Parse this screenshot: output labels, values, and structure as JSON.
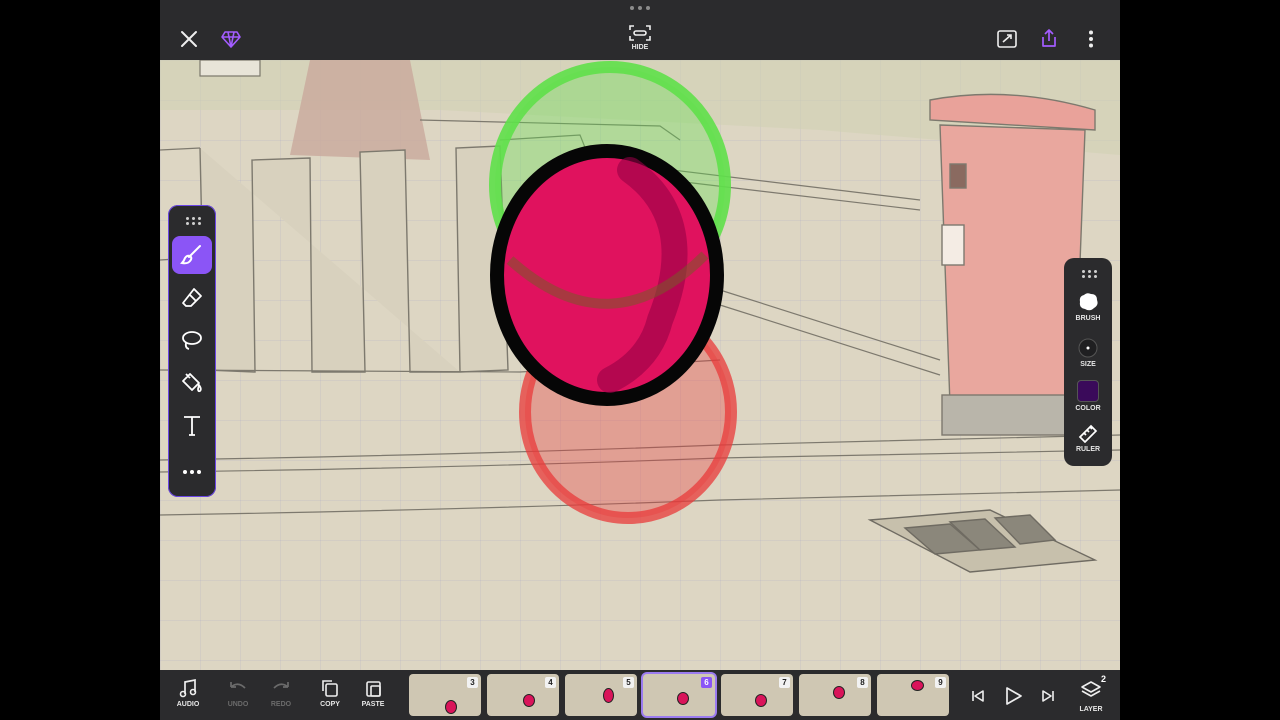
{
  "topbar": {
    "close_icon": "close-icon",
    "premium_icon": "diamond-icon",
    "hide_label": "HIDE",
    "fit_icon": "fit-screen-icon",
    "share_icon": "share-icon",
    "more_icon": "more-vertical-icon"
  },
  "left_tools": [
    {
      "name": "brush-tool",
      "icon": "brush-icon",
      "active": true
    },
    {
      "name": "eraser-tool",
      "icon": "eraser-icon"
    },
    {
      "name": "lasso-tool",
      "icon": "lasso-icon"
    },
    {
      "name": "fill-tool",
      "icon": "paint-bucket-icon"
    },
    {
      "name": "text-tool",
      "icon": "text-icon"
    },
    {
      "name": "more-tools",
      "icon": "more-horizontal-icon"
    }
  ],
  "right_tools": {
    "brush_label": "BRUSH",
    "size_label": "SIZE",
    "color_label": "COLOR",
    "ruler_label": "RULER",
    "current_color": "#3a0a5a"
  },
  "bottombar": {
    "audio_label": "AUDIO",
    "undo_label": "UNDO",
    "redo_label": "REDO",
    "copy_label": "COPY",
    "paste_label": "PASTE",
    "layer_label": "LAYER",
    "layer_count": "2"
  },
  "frames": [
    {
      "number": "3"
    },
    {
      "number": "4"
    },
    {
      "number": "5"
    },
    {
      "number": "6",
      "selected": true
    },
    {
      "number": "7"
    },
    {
      "number": "8"
    },
    {
      "number": "9"
    }
  ],
  "colors": {
    "accent": "#8b55f6",
    "ball": "#e0125e",
    "onion_prev": "#e83a3a",
    "onion_next": "#5fe04a"
  }
}
